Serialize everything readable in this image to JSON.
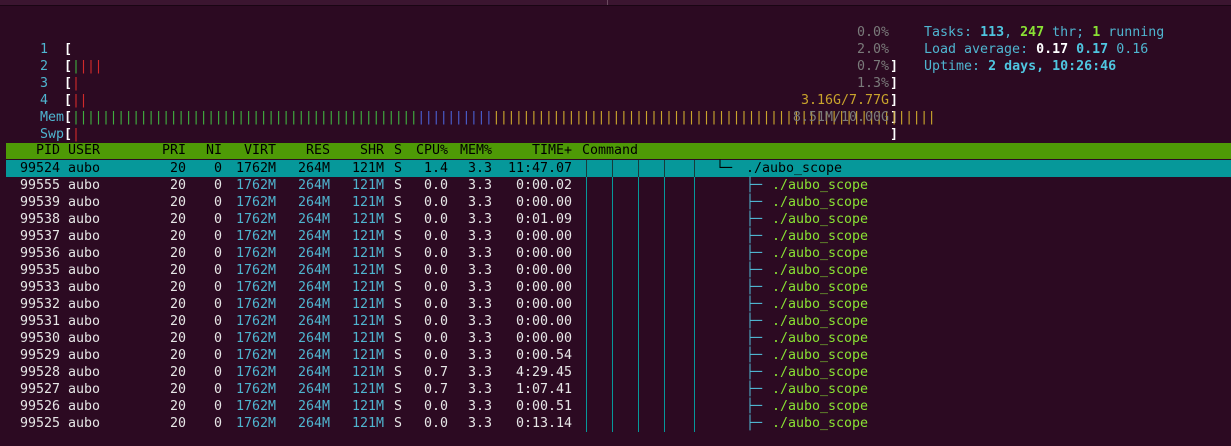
{
  "cpu_meters": [
    {
      "label": "1",
      "value": "0.0%"
    },
    {
      "label": "2",
      "value": "2.0%"
    },
    {
      "label": "3",
      "value": "0.7%"
    },
    {
      "label": "4",
      "value": "1.3%"
    }
  ],
  "mem_meter": {
    "label": "Mem",
    "value": "3.16G/7.77G"
  },
  "swp_meter": {
    "label": "Swp",
    "value": "8.51M/10.00G"
  },
  "tasks": {
    "label": "Tasks:",
    "count": "113",
    "threads": "247",
    "thr_label": "thr;",
    "running": "1",
    "running_label": "running"
  },
  "load": {
    "label": "Load average:",
    "one": "0.17",
    "five": "0.17",
    "fifteen": "0.16"
  },
  "uptime": {
    "label": "Uptime:",
    "value": "2 days, 10:26:46"
  },
  "header": {
    "pid": "PID",
    "user": "USER",
    "pri": "PRI",
    "ni": "NI",
    "virt": "VIRT",
    "res": "RES",
    "shr": "SHR",
    "s": "S",
    "cpu": "CPU%",
    "mem": "MEM%",
    "time": "TIME+",
    "command": "Command"
  },
  "processes": [
    {
      "pid": "99524",
      "user": "aubo",
      "pri": "20",
      "ni": "0",
      "virt": "1762M",
      "res": "264M",
      "shr": "121M",
      "s": "S",
      "cpu": "1.4",
      "mem": "3.3",
      "time": "11:47.07",
      "command": "./aubo_scope",
      "tree": "└─"
    },
    {
      "pid": "99555",
      "user": "aubo",
      "pri": "20",
      "ni": "0",
      "virt": "1762M",
      "res": "264M",
      "shr": "121M",
      "s": "S",
      "cpu": "0.0",
      "mem": "3.3",
      "time": "0:00.02",
      "command": "./aubo_scope",
      "tree": "├─"
    },
    {
      "pid": "99539",
      "user": "aubo",
      "pri": "20",
      "ni": "0",
      "virt": "1762M",
      "res": "264M",
      "shr": "121M",
      "s": "S",
      "cpu": "0.0",
      "mem": "3.3",
      "time": "0:00.00",
      "command": "./aubo_scope",
      "tree": "├─"
    },
    {
      "pid": "99538",
      "user": "aubo",
      "pri": "20",
      "ni": "0",
      "virt": "1762M",
      "res": "264M",
      "shr": "121M",
      "s": "S",
      "cpu": "0.0",
      "mem": "3.3",
      "time": "0:01.09",
      "command": "./aubo_scope",
      "tree": "├─"
    },
    {
      "pid": "99537",
      "user": "aubo",
      "pri": "20",
      "ni": "0",
      "virt": "1762M",
      "res": "264M",
      "shr": "121M",
      "s": "S",
      "cpu": "0.0",
      "mem": "3.3",
      "time": "0:00.00",
      "command": "./aubo_scope",
      "tree": "├─"
    },
    {
      "pid": "99536",
      "user": "aubo",
      "pri": "20",
      "ni": "0",
      "virt": "1762M",
      "res": "264M",
      "shr": "121M",
      "s": "S",
      "cpu": "0.0",
      "mem": "3.3",
      "time": "0:00.00",
      "command": "./aubo_scope",
      "tree": "├─"
    },
    {
      "pid": "99535",
      "user": "aubo",
      "pri": "20",
      "ni": "0",
      "virt": "1762M",
      "res": "264M",
      "shr": "121M",
      "s": "S",
      "cpu": "0.0",
      "mem": "3.3",
      "time": "0:00.00",
      "command": "./aubo_scope",
      "tree": "├─"
    },
    {
      "pid": "99533",
      "user": "aubo",
      "pri": "20",
      "ni": "0",
      "virt": "1762M",
      "res": "264M",
      "shr": "121M",
      "s": "S",
      "cpu": "0.0",
      "mem": "3.3",
      "time": "0:00.00",
      "command": "./aubo_scope",
      "tree": "├─"
    },
    {
      "pid": "99532",
      "user": "aubo",
      "pri": "20",
      "ni": "0",
      "virt": "1762M",
      "res": "264M",
      "shr": "121M",
      "s": "S",
      "cpu": "0.0",
      "mem": "3.3",
      "time": "0:00.00",
      "command": "./aubo_scope",
      "tree": "├─"
    },
    {
      "pid": "99531",
      "user": "aubo",
      "pri": "20",
      "ni": "0",
      "virt": "1762M",
      "res": "264M",
      "shr": "121M",
      "s": "S",
      "cpu": "0.0",
      "mem": "3.3",
      "time": "0:00.00",
      "command": "./aubo_scope",
      "tree": "├─"
    },
    {
      "pid": "99530",
      "user": "aubo",
      "pri": "20",
      "ni": "0",
      "virt": "1762M",
      "res": "264M",
      "shr": "121M",
      "s": "S",
      "cpu": "0.0",
      "mem": "3.3",
      "time": "0:00.00",
      "command": "./aubo_scope",
      "tree": "├─"
    },
    {
      "pid": "99529",
      "user": "aubo",
      "pri": "20",
      "ni": "0",
      "virt": "1762M",
      "res": "264M",
      "shr": "121M",
      "s": "S",
      "cpu": "0.0",
      "mem": "3.3",
      "time": "0:00.54",
      "command": "./aubo_scope",
      "tree": "├─"
    },
    {
      "pid": "99528",
      "user": "aubo",
      "pri": "20",
      "ni": "0",
      "virt": "1762M",
      "res": "264M",
      "shr": "121M",
      "s": "S",
      "cpu": "0.7",
      "mem": "3.3",
      "time": "4:29.45",
      "command": "./aubo_scope",
      "tree": "├─"
    },
    {
      "pid": "99527",
      "user": "aubo",
      "pri": "20",
      "ni": "0",
      "virt": "1762M",
      "res": "264M",
      "shr": "121M",
      "s": "S",
      "cpu": "0.7",
      "mem": "3.3",
      "time": "1:07.41",
      "command": "./aubo_scope",
      "tree": "├─"
    },
    {
      "pid": "99526",
      "user": "aubo",
      "pri": "20",
      "ni": "0",
      "virt": "1762M",
      "res": "264M",
      "shr": "121M",
      "s": "S",
      "cpu": "0.0",
      "mem": "3.3",
      "time": "0:00.51",
      "command": "./aubo_scope",
      "tree": "├─"
    },
    {
      "pid": "99525",
      "user": "aubo",
      "pri": "20",
      "ni": "0",
      "virt": "1762M",
      "res": "264M",
      "shr": "121M",
      "s": "S",
      "cpu": "0.0",
      "mem": "3.3",
      "time": "0:13.14",
      "command": "./aubo_scope",
      "tree": "├─"
    }
  ],
  "colors": {
    "header_bg": "#4e9a06",
    "selected_bg": "#06989a",
    "terminal_bg": "#2c0a22",
    "cyan": "#4fb5d0",
    "green": "#8ae234"
  }
}
